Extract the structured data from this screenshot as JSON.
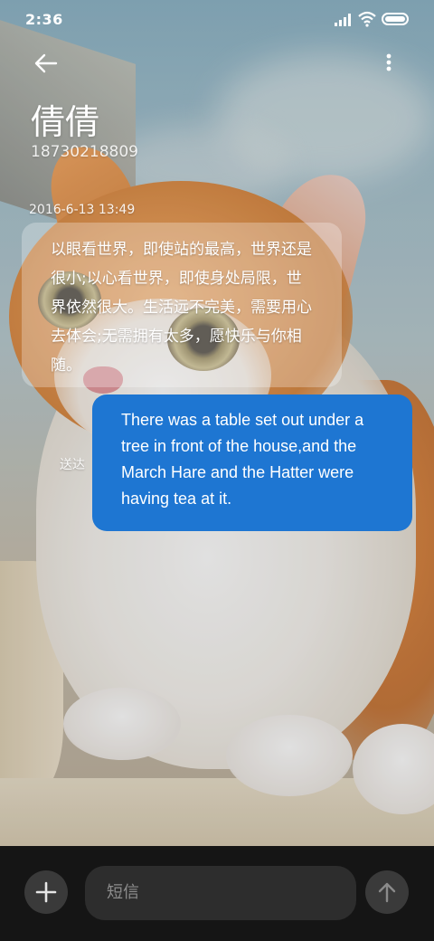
{
  "status_bar": {
    "time": "2:36"
  },
  "header": {
    "contact_name": "倩倩",
    "phone_number": "18730218809"
  },
  "conversation": {
    "timestamp": "2016-6-13 13:49",
    "incoming_message": "以眼看世界，即使站的最高，世界还是很小;以心看世界，即使身处局限，世界依然很大。生活远不完美，需要用心去体会;无需拥有太多，愿快乐与你相随。",
    "outgoing_message": "There was a table set out under a tree in front of the house,and the March Hare and the Hatter were having tea at it.",
    "delivery_status": "送达"
  },
  "composer": {
    "placeholder": "短信"
  },
  "colors": {
    "outgoing_bubble": "#1e76d2",
    "bottom_bar": "#151515",
    "input_field": "#2d2d2d"
  },
  "icons": {
    "back": "arrow-left-icon",
    "more": "more-vertical-icon",
    "add": "plus-icon",
    "send": "arrow-up-icon"
  }
}
